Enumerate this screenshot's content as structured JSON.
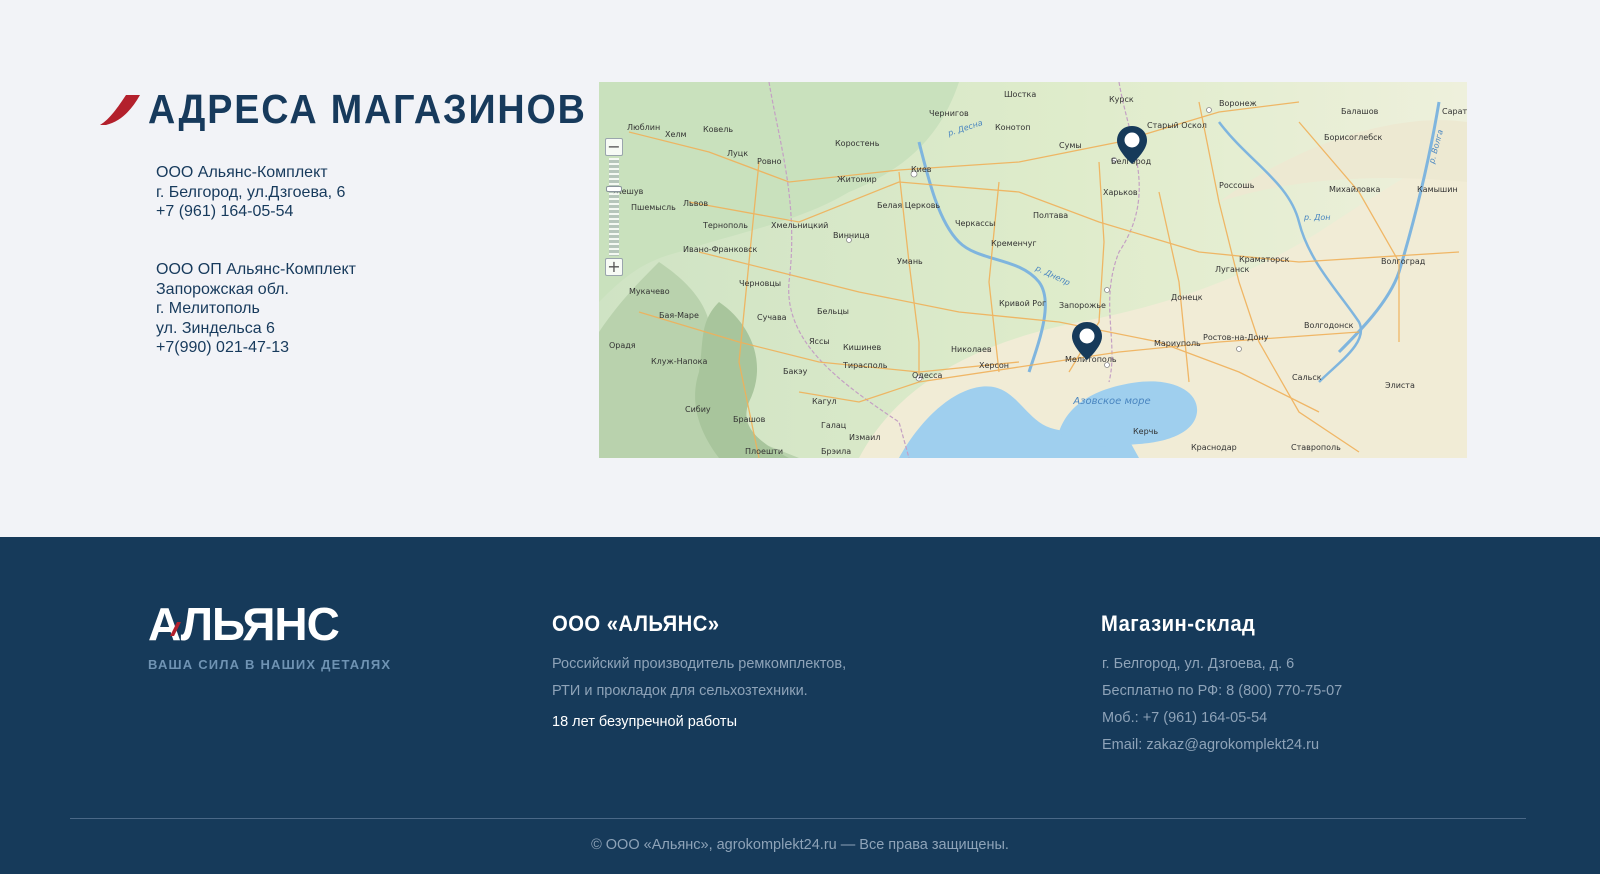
{
  "stores": {
    "title": "АДРЕСА МАГАЗИНОВ",
    "addresses": [
      {
        "lines": [
          "ООО Альянс-Комплект",
          "г. Белгород, ул.Дзгоева, 6",
          "+7 (961) 164-05-54"
        ]
      },
      {
        "lines": [
          "ООО ОП Альянс-Комплект",
          "Запорожская обл.",
          "г. Мелитополь",
          "ул. Зиндельса 6",
          "+7(990) 021-47-13"
        ]
      }
    ]
  },
  "map": {
    "zoom_in": "+",
    "zoom_out": "−",
    "labels": {
      "kursk": "Курск",
      "voronezh": "Воронеж",
      "balashov": "Балашов",
      "saratov": "Сарато",
      "shostka": "Шостка",
      "chernigov": "Чернигов",
      "konotop": "Конотоп",
      "stary_oskol": "Старый Оскол",
      "sumy": "Сумы",
      "belgorod": "Белгород",
      "borisoglebsk": "Борисоглебск",
      "lublin": "Люблин",
      "kovel": "Ковель",
      "helm": "Хелм",
      "korosten": "Коростень",
      "lutsk": "Луцк",
      "rovno": "Ровно",
      "kiev": "Киев",
      "zhitomir": "Житомир",
      "kharkov": "Харьков",
      "rossosh": "Россошь",
      "mikhaylovka": "Михайловка",
      "kamyshin": "Камышин",
      "peremyshl": "Пшемысль",
      "lvov": "Львов",
      "zheshuv": "Жешув",
      "belaya_tserkov": "Белая Церковь",
      "poltava": "Полтава",
      "ternopol": "Тернополь",
      "khmelnitsky": "Хмельницкий",
      "cherkassy": "Черкассы",
      "vinnitsa": "Винница",
      "kremenchug": "Кременчуг",
      "ivano_frankovsk": "Ивано-Франковск",
      "kramatorsk": "Краматорск",
      "lugansk": "Луганск",
      "volgograd": "Волгоград",
      "uman": "Умань",
      "chernovtsy": "Черновцы",
      "mukachevo": "Мукачево",
      "krivoy_rog": "Кривой Рог",
      "zaporozhye": "Запорожье",
      "donetsk": "Донецк",
      "baya_mare": "Бая-Маре",
      "suchava": "Сучава",
      "beltsy": "Бельцы",
      "rostov": "Ростов-на-Дону",
      "mariupol": "Мариуполь",
      "volgodonsk": "Волгодонск",
      "oradea": "Орадя",
      "kishinev": "Кишинев",
      "yassy": "Яссы",
      "nikolaev": "Николаев",
      "kherson": "Херсон",
      "melitopol": "Мелитополь",
      "odessa": "Одесса",
      "tiraspol": "Тирасполь",
      "cluj": "Клуж-Напока",
      "bakau": "Бакэу",
      "salsk": "Сальск",
      "elista": "Элиста",
      "azov_sea": "Азовское море",
      "kagul": "Кагул",
      "sibiu": "Сибиу",
      "brashov": "Брашов",
      "galats": "Галац",
      "izmail": "Измаил",
      "kerch": "Керчь",
      "krasnodar": "Краснодар",
      "stavropol": "Ставрополь",
      "ploeshti": "Плоешти",
      "braila": "Брэила",
      "dnepr": "р. Днепр",
      "don": "р. Дон",
      "desna": "р. Десна",
      "volga": "р. Волга"
    }
  },
  "footer": {
    "logo_text": "АЛЬЯНС",
    "tagline": "ВАША СИЛА В НАШИХ ДЕТАЛЯХ",
    "company_title": "ООО «АЛЬЯНС»",
    "company_desc": [
      "Российский производитель ремкомплектов,",
      "РТИ и прокладок для сельхозтехники."
    ],
    "company_highlight": "18 лет безупречной работы",
    "store_title": "Магазин-склад",
    "store_lines": [
      "г. Белгород, ул. Дзгоева, д. 6",
      "Бесплатно по РФ: 8 (800) 770-75-07",
      "Моб.: +7 (961) 164-05-54",
      "Email: zakaz@agrokomplekt24.ru"
    ],
    "copyright": "© ООО «Альянс», agrokomplekt24.ru — Все права защищены."
  },
  "colors": {
    "brand_navy": "#163a5a",
    "title_navy": "#173a5c",
    "accent_red": "#b3202c",
    "footer_muted": "#8ea3b8",
    "tagline_blue": "#6f93b3"
  }
}
